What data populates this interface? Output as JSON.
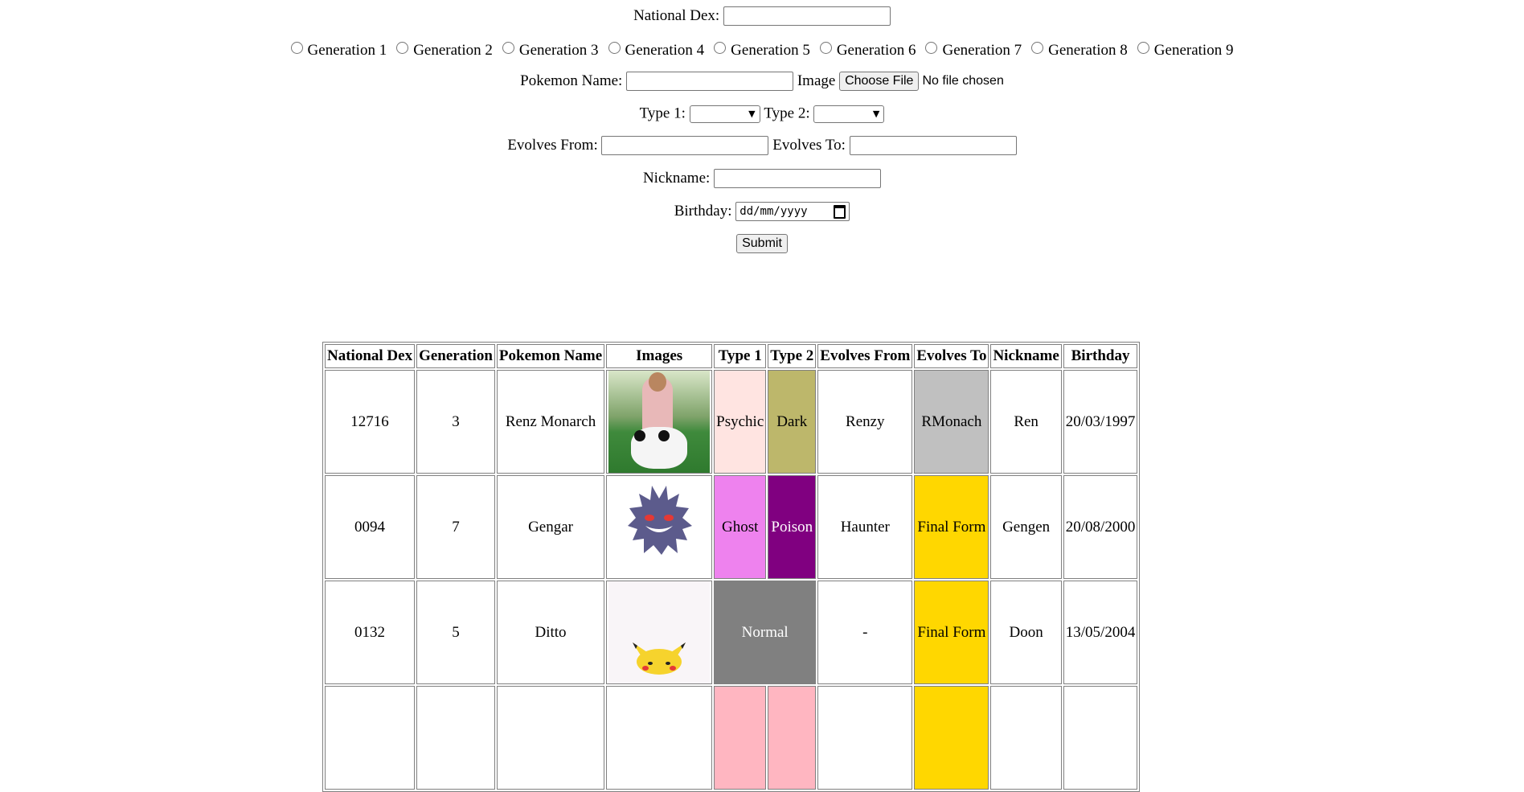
{
  "form": {
    "national_dex_label": "National Dex:",
    "generations": [
      "Generation 1",
      "Generation 2",
      "Generation 3",
      "Generation 4",
      "Generation 5",
      "Generation 6",
      "Generation 7",
      "Generation 8",
      "Generation 9"
    ],
    "name_label": "Pokemon Name:",
    "image_label": "Image",
    "choose_file": "Choose File",
    "no_file": "No file chosen",
    "type1_label": "Type 1:",
    "type2_label": "Type 2:",
    "evolves_from_label": "Evolves From:",
    "evolves_to_label": "Evolves To:",
    "nickname_label": "Nickname:",
    "birthday_label": "Birthday:",
    "birthday_placeholder": "dd/mm/yyyy",
    "submit": "Submit"
  },
  "table": {
    "headers": [
      "National Dex",
      "Generation",
      "Pokemon Name",
      "Images",
      "Type 1",
      "Type 2",
      "Evolves From",
      "Evolves To",
      "Nickname",
      "Birthday"
    ],
    "rows": [
      {
        "dex": "12716",
        "gen": "3",
        "name": "Renz Monarch",
        "image": "photo-person-on-panda",
        "type1": "Psychic",
        "type2": "Dark",
        "evolves_from": "Renzy",
        "evolves_to": "RMonach",
        "nickname": "Ren",
        "birthday": "20/03/1997",
        "type1_color": "#ffe4e1",
        "type2_color": "#bdb76b",
        "evolves_to_color": "#c0c0c0"
      },
      {
        "dex": "0094",
        "gen": "7",
        "name": "Gengar",
        "image": "gengar-sprite",
        "type1": "Ghost",
        "type2": "Poison",
        "evolves_from": "Haunter",
        "evolves_to": "Final Form",
        "nickname": "Gengen",
        "birthday": "20/08/2000",
        "type1_color": "#ee82ee",
        "type2_color": "#800080",
        "evolves_to_color": "#ffd700"
      },
      {
        "dex": "0132",
        "gen": "5",
        "name": "Ditto",
        "image": "pikachu-sprite",
        "type1": "Normal",
        "evolves_from": "-",
        "evolves_to": "Final Form",
        "nickname": "Doon",
        "birthday": "13/05/2004",
        "type1_color": "#808080",
        "evolves_to_color": "#ffd700"
      }
    ]
  }
}
